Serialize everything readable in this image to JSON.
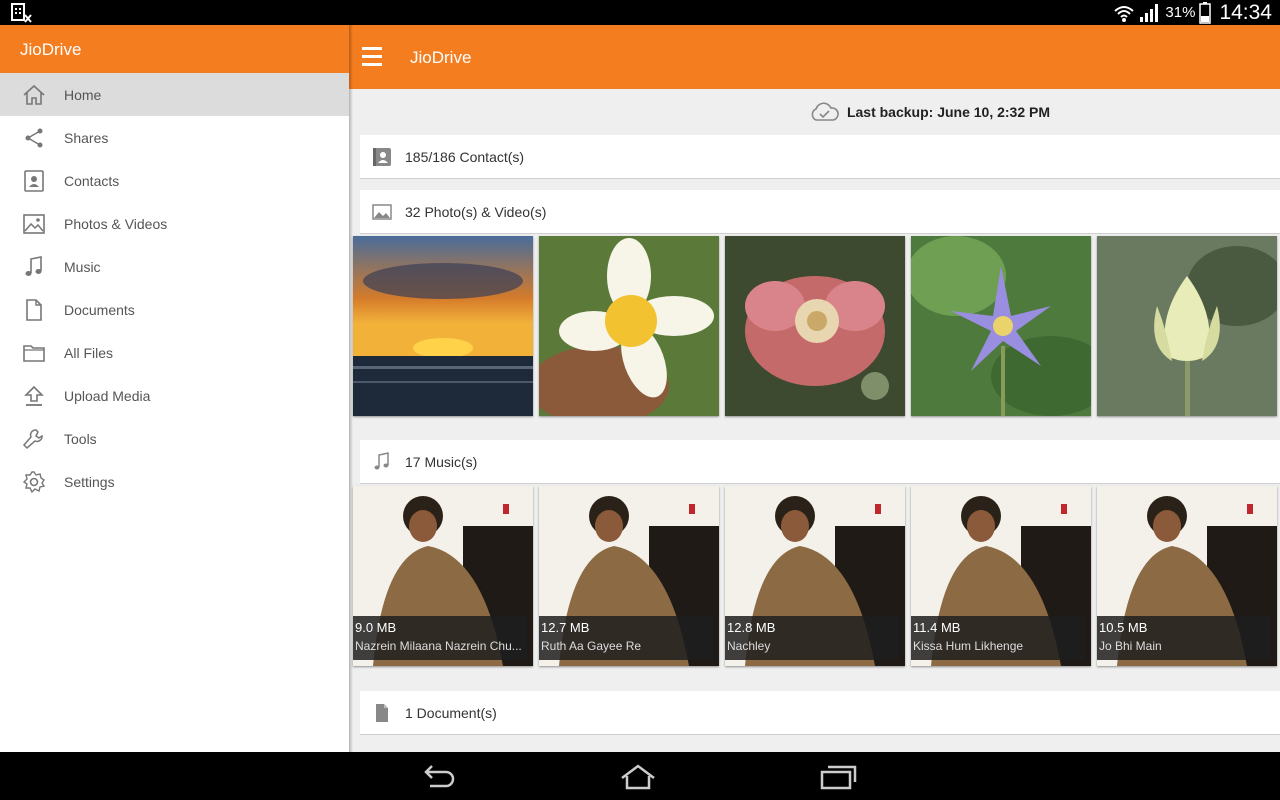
{
  "status_bar": {
    "battery": "31%",
    "time": "14:34"
  },
  "drawer": {
    "title": "JioDrive",
    "items": [
      {
        "label": "Home",
        "icon": "home-icon",
        "active": true
      },
      {
        "label": "Shares",
        "icon": "share-icon"
      },
      {
        "label": "Contacts",
        "icon": "contacts-icon"
      },
      {
        "label": "Photos & Videos",
        "icon": "image-icon"
      },
      {
        "label": "Music",
        "icon": "music-icon"
      },
      {
        "label": "Documents",
        "icon": "document-icon"
      },
      {
        "label": "All Files",
        "icon": "folder-icon"
      },
      {
        "label": "Upload Media",
        "icon": "upload-icon"
      },
      {
        "label": "Tools",
        "icon": "wrench-icon"
      },
      {
        "label": "Settings",
        "icon": "gear-icon"
      }
    ]
  },
  "appbar": {
    "title": "JioDrive"
  },
  "backup": {
    "text": "Last backup: June 10, 2:32 PM"
  },
  "sections": {
    "contacts": {
      "label": "185/186 Contact(s)"
    },
    "photos": {
      "label": "32 Photo(s) & Video(s)"
    },
    "music": {
      "label": "17 Music(s)",
      "items": [
        {
          "size": "9.0 MB",
          "name": "Nazrein Milaana Nazrein Chu..."
        },
        {
          "size": "12.7 MB",
          "name": "Ruth Aa Gayee Re"
        },
        {
          "size": "12.8 MB",
          "name": "Nachley"
        },
        {
          "size": "11.4 MB",
          "name": "Kissa Hum Likhenge"
        },
        {
          "size": "10.5 MB",
          "name": "Jo Bhi Main"
        }
      ]
    },
    "documents": {
      "label": "1 Document(s)"
    }
  },
  "colors": {
    "accent": "#f47d20",
    "drawer_active": "#dcdcdc",
    "background": "#efefef"
  }
}
